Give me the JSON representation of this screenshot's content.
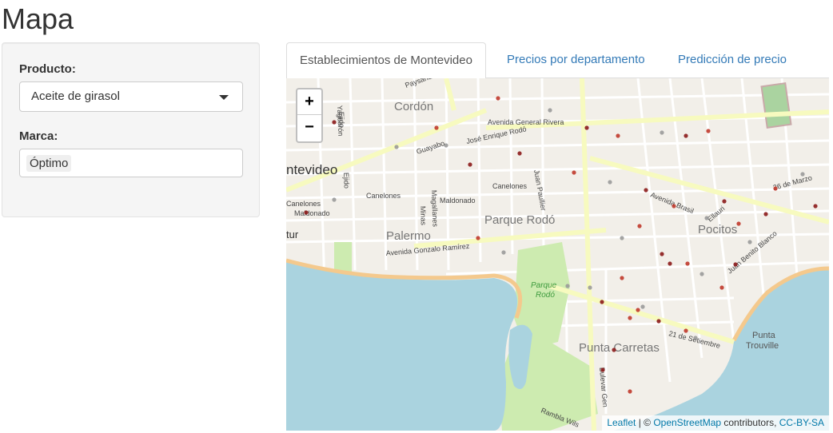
{
  "page": {
    "title": "Mapa"
  },
  "sidebar": {
    "producto_label": "Producto:",
    "producto_value": "Aceite de girasol",
    "marca_label": "Marca:",
    "marca_chip": "Óptimo"
  },
  "tabs": [
    {
      "label": "Establecimientos de Montevideo",
      "active": true
    },
    {
      "label": "Precios por departamento",
      "active": false
    },
    {
      "label": "Predicción de precio",
      "active": false
    }
  ],
  "map": {
    "zoom_in": "+",
    "zoom_out": "−",
    "attribution": {
      "leaflet": "Leaflet",
      "sep": " | © ",
      "osm": "OpenStreetMap",
      "contrib": " contributors, ",
      "license": "CC-BY-SA"
    },
    "labels": {
      "cordon": "Cordón",
      "montevideo": "ntevideo",
      "parque_rodo": "Parque Rodó",
      "palermo": "Palermo",
      "pocitos": "Pocitos",
      "punta_carretas": "Punta Carretas",
      "punta_trouville_1": "Punta",
      "punta_trouville_2": "Trouville",
      "parque_rodo_green_1": "Parque",
      "parque_rodo_green_2": "Rodó",
      "av_general_rivera": "Avenida General Rivera",
      "jose_enrique_rodo": "José Enrique Rodó",
      "juan_paullier": "Juan Paullier",
      "guayabo": "Guayabo",
      "canelones_1": "Canelones",
      "canelones_2": "Canelones",
      "canelones_3": "Canelones",
      "maldonado_1": "Maldonado",
      "maldonado_2": "Maldonado",
      "magallanes": "Magallanes",
      "minas": "Minas",
      "av_gonzalo_ramirez": "Avenida Gonzalo Ramírez",
      "avenida_brasil": "Avenida Brasil",
      "ellauri": "Ellauri",
      "benito_blanco": "Juan Benito Blanco",
      "de_marzo": "26 de Marzo",
      "setiembre": "21 de Setiembre",
      "bulevar_gen": "Bulevar Gen",
      "rambla_wilson": "Rambla Wils",
      "yaguaron": "Yaguarón",
      "ejido_1": "Ejido",
      "ejido_2": "Ejido",
      "paysandu": "Paysandú",
      "tur": "tur"
    },
    "colors": {
      "water": "#aad3df",
      "land": "#f2efe9",
      "park": "#cdebb0",
      "major_road": "#f7fabf",
      "marker": "#b22222"
    }
  }
}
